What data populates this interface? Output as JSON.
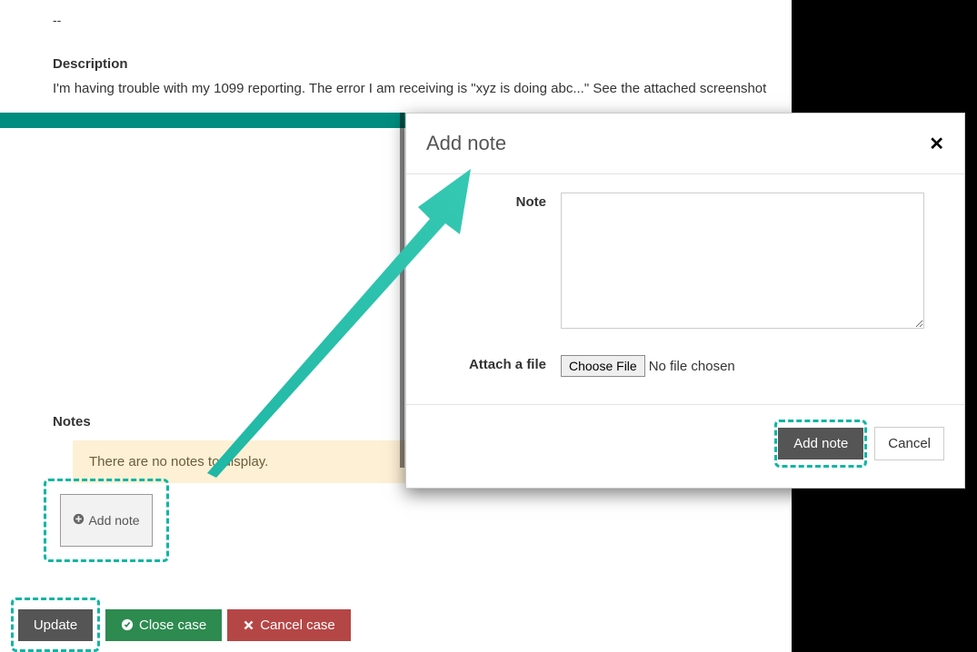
{
  "case": {
    "placeholder_top": "--",
    "description_heading": "Description",
    "description_body": "I'm having trouble with my 1099 reporting. The error I am receiving is \"xyz is doing abc...\" See the attached screenshot",
    "notes_heading": "Notes",
    "notes_empty": "There are no notes to display."
  },
  "buttons": {
    "add_note": "Add note",
    "update": "Update",
    "close_case": "Close case",
    "cancel_case": "Cancel case"
  },
  "modal": {
    "title": "Add note",
    "note_label": "Note",
    "attach_label": "Attach a file",
    "choose_file": "Choose File",
    "no_file": "No file chosen",
    "submit": "Add note",
    "cancel": "Cancel"
  },
  "colors": {
    "teal_highlight": "#0fb5a4",
    "green_btn": "#2d8b4f",
    "red_btn": "#b54646",
    "gray_btn": "#555555",
    "notes_bg": "#fdf0d4"
  }
}
